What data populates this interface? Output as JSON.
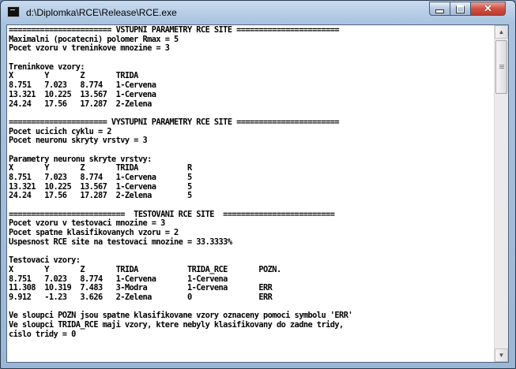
{
  "window": {
    "title": "d:\\Diplomka\\RCE\\Release\\RCE.exe",
    "icons": {
      "app": "console-icon",
      "minimize": "minimize-icon",
      "maximize": "maximize-icon",
      "close": "close-icon"
    },
    "close_glyph": "✕"
  },
  "scrollbar": {
    "up_glyph": "▲",
    "down_glyph": "▼"
  },
  "console": {
    "lines": [
      "======================= VSTUPNI PARAMETRY RCE SITE =======================",
      "Maximalni (pocatecni) polomer Rmax = 5",
      "Pocet vzoru v treninkove mnozine = 3",
      "",
      "Treninkove vzory:",
      "X       Y       Z       TRIDA",
      "8.751   7.023   8.774   1-Cervena",
      "13.321  10.225  13.567  1-Cervena",
      "24.24   17.56   17.287  2-Zelena",
      "",
      "====================== VYSTUPNI PARAMETRY RCE SITE =======================",
      "Pocet ucicich cyklu = 2",
      "Pocet neuronu skryty vrstvy = 3",
      "",
      "Parametry neuronu skryte vrstvy:",
      "X       Y       Z       TRIDA           R",
      "8.751   7.023   8.774   1-Cervena       5",
      "13.321  10.225  13.567  1-Cervena       5",
      "24.24   17.56   17.287  2-Zelena        5",
      "",
      "==========================  TESTOVANI RCE SITE  =========================",
      "Pocet vzoru v testovaci mnozine = 3",
      "Pocet spatne klasifikovanych vzoru = 2",
      "Uspesnost RCE site na testovaci mnozine = 33.3333%",
      "",
      "Testovaci vzory:",
      "X       Y       Z       TRIDA           TRIDA_RCE       POZN.",
      "8.751   7.023   8.774   1-Cervena       1-Cervena",
      "11.308  10.319  7.483   3-Modra         1-Cervena       ERR",
      "9.912   -1.23   3.626   2-Zelena        0               ERR",
      "",
      "Ve sloupci POZN jsou spatne klasifikovane vzory oznaceny pomoci symbolu 'ERR'",
      "Ve sloupci TRIDA_RCE maji vzory, ktere nebyly klasifikovany do zadne tridy,",
      "cislo tridy = 0"
    ]
  }
}
